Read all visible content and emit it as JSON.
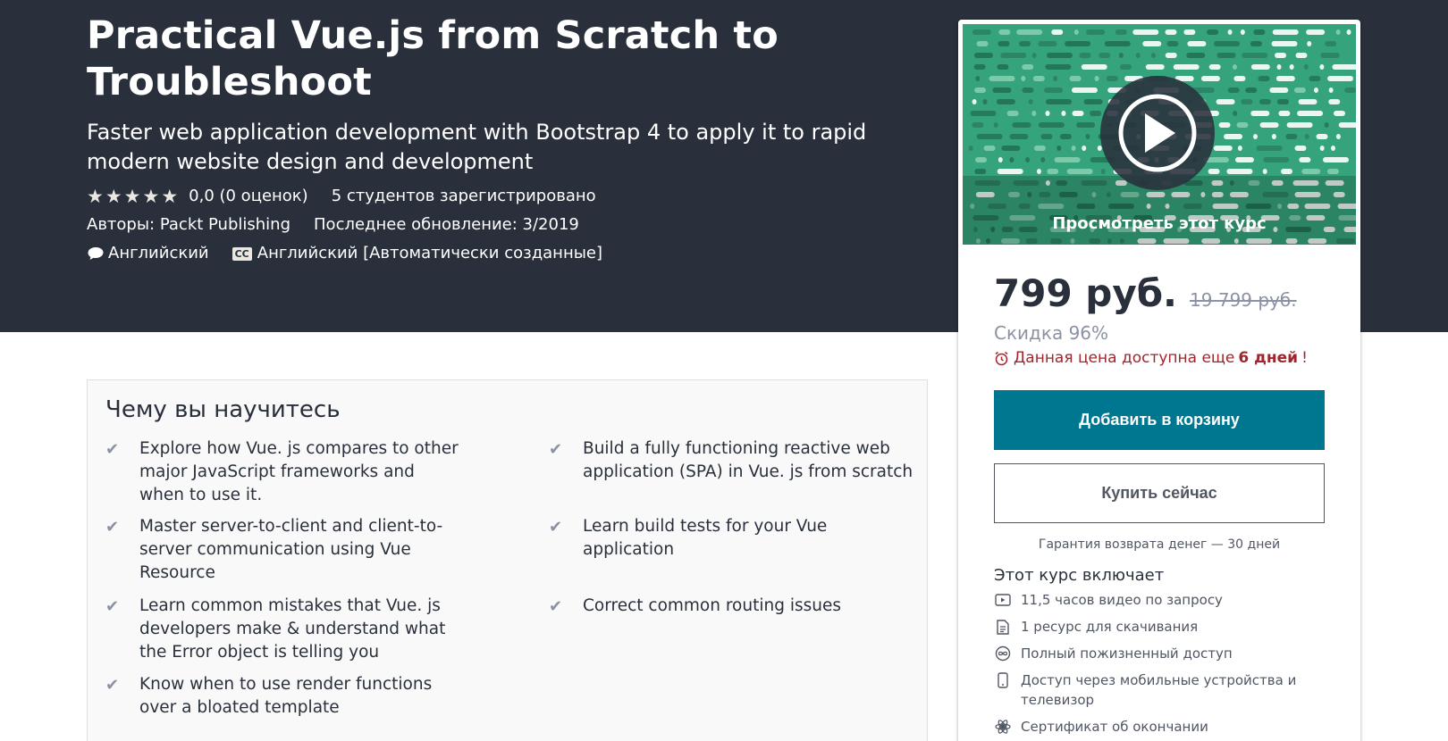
{
  "course": {
    "title_line1": "Practical Vue.js from Scratch to",
    "title_line2": "Troubleshoot",
    "subtitle_line1": "Faster web application development with Bootstrap 4 to apply it to rapid",
    "subtitle_line2": "modern website design and development",
    "rating_text": "0,0 (0 оценок)",
    "rating_value": 0,
    "stars_total": 5,
    "students_text": "5 студентов зарегистрировано",
    "authors_text": "Авторы: Packt Publishing",
    "updated_text": "Последнее обновление: 3/2019",
    "language": "Английский",
    "captions_badge": "CC",
    "captions_text": "Английский [Автоматически созданные]"
  },
  "sidebar": {
    "preview_label": "Просмотреть этот курс",
    "price_current": "799 руб.",
    "price_old": "19 799 руб.",
    "discount": "Скидка 96%",
    "timer_prefix": "Данная цена доступна еще",
    "timer_days": "6 дней",
    "timer_suffix": "!",
    "add_to_cart": "Добавить в корзину",
    "buy_now": "Купить сейчас",
    "guarantee": "Гарантия возврата денег — 30 дней",
    "includes_title": "Этот курс включает",
    "includes": [
      {
        "icon": "video-icon",
        "text": "11,5 часов видео по запросу"
      },
      {
        "icon": "file-icon",
        "text": "1 ресурс для скачивания"
      },
      {
        "icon": "infinity-icon",
        "text": "Полный пожизненный доступ"
      },
      {
        "icon": "mobile-icon",
        "text": "Доступ через мобильные устройства и телевизор"
      },
      {
        "icon": "certificate-icon",
        "text": "Сертификат об окончании"
      }
    ]
  },
  "learn": {
    "title": "Чему вы научитесь",
    "left": [
      "Explore how Vue. js compares to other major JavaScript frameworks and when to use it.",
      "Master server-to-client and client-to-server communication using Vue Resource",
      "Learn common mistakes that Vue. js developers make & understand what the Error object is telling you",
      "Know when to use render functions over a bloated template"
    ],
    "right": [
      "Build a fully functioning reactive web application (SPA) in Vue. js from scratch",
      "Learn build tests for your Vue application",
      "Correct common routing issues"
    ]
  },
  "colors": {
    "hero_bg": "#29303b",
    "primary": "#007791",
    "alert": "#a1252d",
    "preview_green": "#35a37b"
  }
}
